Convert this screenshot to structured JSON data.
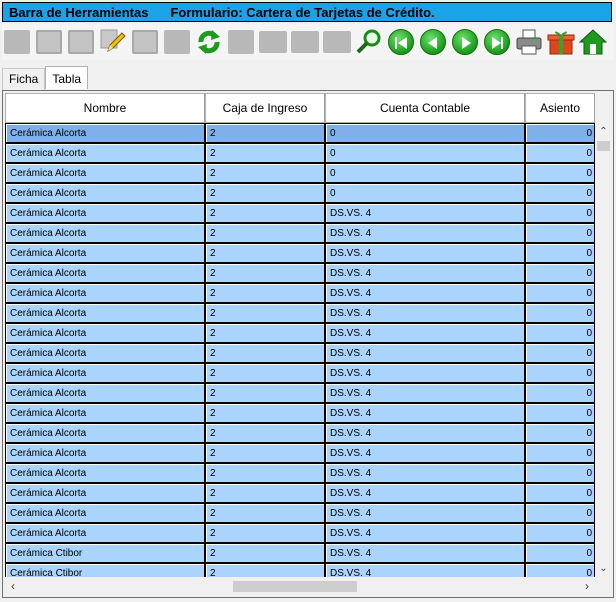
{
  "titlebar": {
    "left": "Barra de Herramientas",
    "form": "Formulario: Cartera de Tarjetas de Crédito."
  },
  "toolbar": {
    "buttons": [
      {
        "name": "new-record-button",
        "icon": "new-record-icon",
        "enabled": false
      },
      {
        "name": "save-button",
        "icon": "floppy-icon",
        "enabled": false
      },
      {
        "name": "save-as-button",
        "icon": "floppy-icon",
        "enabled": false
      },
      {
        "name": "edit-button",
        "icon": "pencil-icon",
        "enabled": true
      },
      {
        "name": "save-disabled-button",
        "icon": "floppy-icon",
        "enabled": false
      },
      {
        "name": "undo-button",
        "icon": "undo-icon",
        "enabled": false
      },
      {
        "name": "refresh-button",
        "icon": "refresh-icon",
        "enabled": true
      },
      {
        "name": "film-button",
        "icon": "film-icon",
        "enabled": false
      },
      {
        "name": "disabled-button-1",
        "icon": "box-icon",
        "enabled": false
      },
      {
        "name": "disabled-button-2",
        "icon": "box-icon",
        "enabled": false
      },
      {
        "name": "disabled-button-3",
        "icon": "box-icon",
        "enabled": false
      },
      {
        "name": "search-button",
        "icon": "magnifier-icon",
        "enabled": true
      },
      {
        "name": "first-record-button",
        "icon": "first-icon",
        "enabled": true
      },
      {
        "name": "prev-record-button",
        "icon": "prev-icon",
        "enabled": true
      },
      {
        "name": "next-record-button",
        "icon": "next-icon",
        "enabled": true
      },
      {
        "name": "last-record-button",
        "icon": "last-icon",
        "enabled": true
      },
      {
        "name": "print-button",
        "icon": "printer-icon",
        "enabled": true
      },
      {
        "name": "gift-button",
        "icon": "gift-icon",
        "enabled": true
      },
      {
        "name": "home-button",
        "icon": "home-icon",
        "enabled": true
      }
    ]
  },
  "tabs": [
    {
      "label": "Ficha",
      "active": false
    },
    {
      "label": "Tabla",
      "active": true
    }
  ],
  "table": {
    "columns": [
      "Nombre",
      "Caja de Ingreso",
      "Cuenta Contable",
      "Asiento"
    ],
    "rows": [
      [
        "Cerámica Alcorta",
        "2",
        "0",
        "0"
      ],
      [
        "Cerámica Alcorta",
        "2",
        "0",
        "0"
      ],
      [
        "Cerámica Alcorta",
        "2",
        "0",
        "0"
      ],
      [
        "Cerámica Alcorta",
        "2",
        "0",
        "0"
      ],
      [
        "Cerámica Alcorta",
        "2",
        "DS.VS. 4",
        "0"
      ],
      [
        "Cerámica Alcorta",
        "2",
        "DS.VS. 4",
        "0"
      ],
      [
        "Cerámica Alcorta",
        "2",
        "DS.VS. 4",
        "0"
      ],
      [
        "Cerámica Alcorta",
        "2",
        "DS.VS. 4",
        "0"
      ],
      [
        "Cerámica Alcorta",
        "2",
        "DS.VS. 4",
        "0"
      ],
      [
        "Cerámica Alcorta",
        "2",
        "DS.VS. 4",
        "0"
      ],
      [
        "Cerámica Alcorta",
        "2",
        "DS.VS. 4",
        "0"
      ],
      [
        "Cerámica Alcorta",
        "2",
        "DS.VS. 4",
        "0"
      ],
      [
        "Cerámica Alcorta",
        "2",
        "DS.VS. 4",
        "0"
      ],
      [
        "Cerámica Alcorta",
        "2",
        "DS.VS. 4",
        "0"
      ],
      [
        "Cerámica Alcorta",
        "2",
        "DS.VS. 4",
        "0"
      ],
      [
        "Cerámica Alcorta",
        "2",
        "DS.VS. 4",
        "0"
      ],
      [
        "Cerámica Alcorta",
        "2",
        "DS.VS. 4",
        "0"
      ],
      [
        "Cerámica Alcorta",
        "2",
        "DS.VS. 4",
        "0"
      ],
      [
        "Cerámica Alcorta",
        "2",
        "DS.VS. 4",
        "0"
      ],
      [
        "Cerámica Alcorta",
        "2",
        "DS.VS. 4",
        "0"
      ],
      [
        "Cerámica Alcorta",
        "2",
        "DS.VS. 4",
        "0"
      ],
      [
        "Cerámica Ctibor",
        "2",
        "DS.VS. 4",
        "0"
      ],
      [
        "Cerámica Ctibor",
        "2",
        "DS.VS. 4",
        "0"
      ]
    ],
    "selected_row": 0
  },
  "colors": {
    "titlebar": "#1aa3e8",
    "row_bg": "#aad4fb",
    "row_selected": "#7fb0ea"
  }
}
